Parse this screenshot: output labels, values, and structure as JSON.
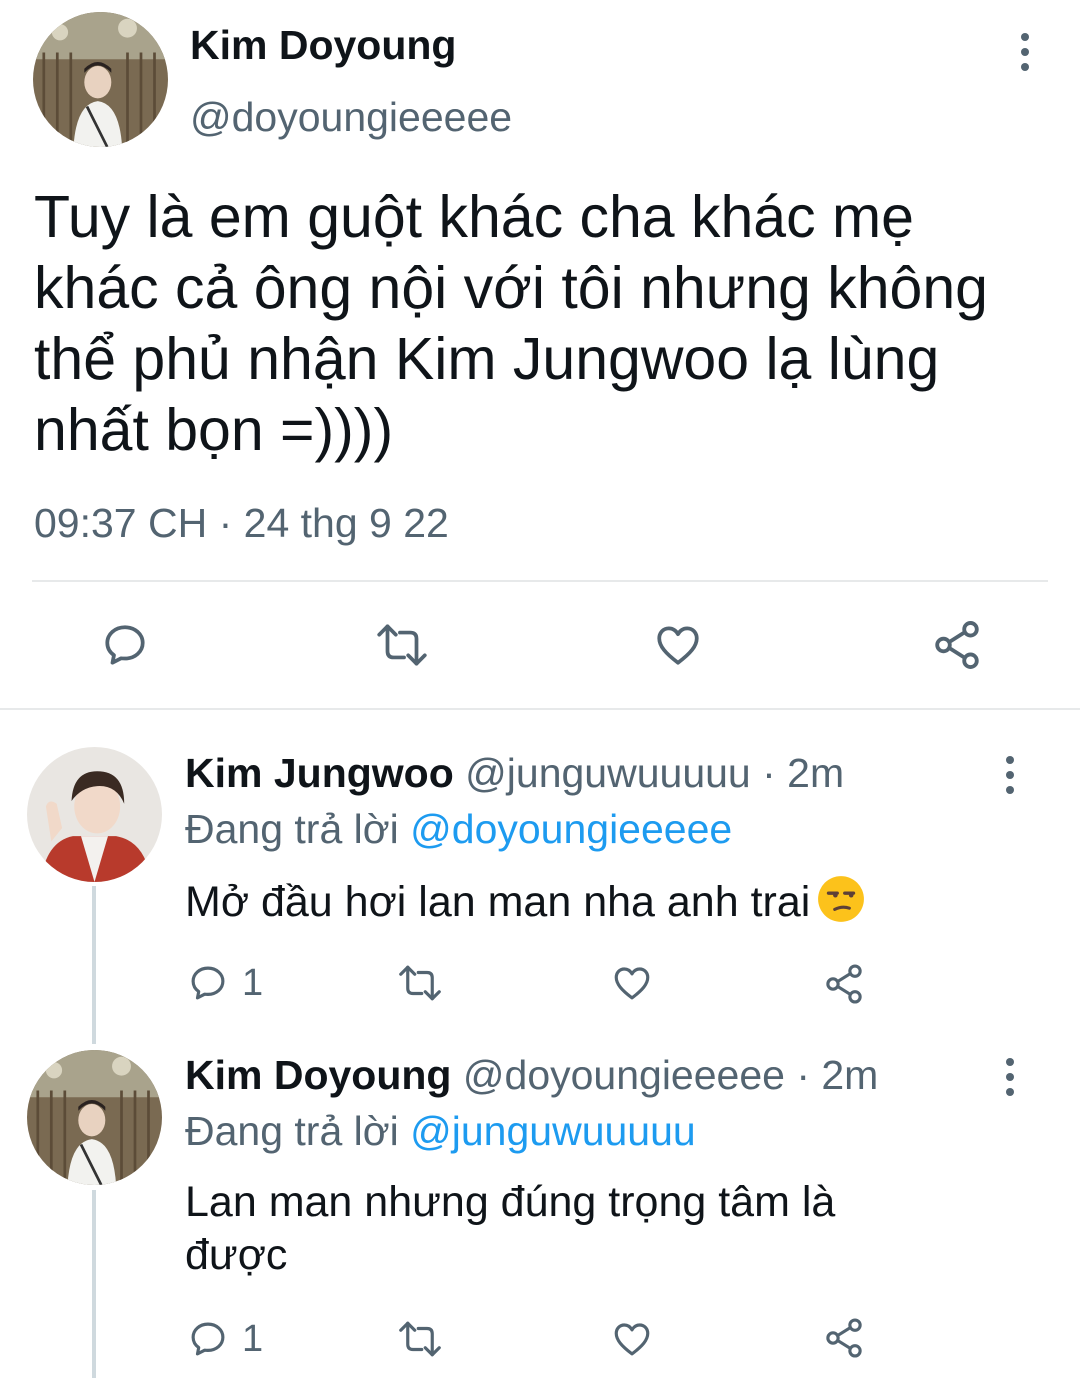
{
  "main_tweet": {
    "name": "Kim Doyoung",
    "handle": "@doyoungieeeee",
    "text": "Tuy là em guột khác cha khác mẹ khác cả ông nội với tôi nhưng không thể phủ nhận Kim Jungwoo lạ lùng nhất bọn =))))",
    "timestamp": "09:37 CH · 24 thg 9 22",
    "actions": [
      "reply-icon",
      "retweet-icon",
      "like-icon",
      "share-icon"
    ]
  },
  "replies": [
    {
      "name": "Kim Jungwoo",
      "handle": "@junguwuuuuu · 2m",
      "replying_prefix": "Đang trả lời ",
      "replying_to": "@doyoungieeeee",
      "text": "Mở đầu hơi lan man nha anh trai",
      "emoji": "unamused-face-emoji",
      "reply_count": "1"
    },
    {
      "name": "Kim Doyoung",
      "handle": "@doyoungieeeee · 2m",
      "replying_prefix": "Đang trả lời ",
      "replying_to": "@junguwuuuuu",
      "text": "Lan man nhưng đúng trọng tâm là được",
      "reply_count": "1"
    }
  ],
  "colors": {
    "text_primary": "#0f1419",
    "text_secondary": "#536471",
    "link": "#1d9bf0",
    "divider": "#e7e9ea",
    "thread_line": "#cfd9de"
  }
}
